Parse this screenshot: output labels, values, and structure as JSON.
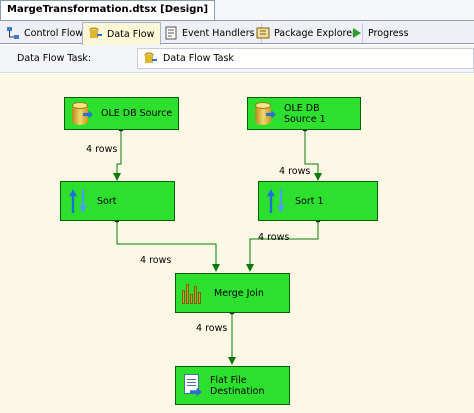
{
  "window": {
    "doc_tab": "MargeTransformation.dtsx [Design]"
  },
  "tabs": [
    {
      "label": "Control Flow",
      "icon": "control-flow-icon"
    },
    {
      "label": "Data Flow",
      "icon": "data-flow-icon"
    },
    {
      "label": "Event Handlers",
      "icon": "event-handlers-icon"
    },
    {
      "label": "Package Explorer",
      "icon": "package-explorer-icon"
    },
    {
      "label": "Progress",
      "icon": "progress-icon"
    }
  ],
  "active_tab": "Data Flow",
  "task": {
    "label": "Data Flow Task:",
    "value": "Data Flow Task"
  },
  "colors": {
    "node_fill": "#2ee02e",
    "node_border": "#0a5e0a",
    "canvas": "#fdf8e5",
    "link": "#0b7a0b"
  },
  "nodes": {
    "source1": {
      "label": "OLE DB Source"
    },
    "source2": {
      "label": "OLE DB Source 1"
    },
    "sort1": {
      "label": "Sort"
    },
    "sort2": {
      "label": "Sort 1"
    },
    "merge": {
      "label": "Merge Join"
    },
    "dest": {
      "label": "Flat File Destination"
    }
  },
  "links": {
    "source1_sort": "4 rows",
    "source2_sort1": "4 rows",
    "sort_merge": "4 rows",
    "sort1_merge": "4 rows",
    "merge_dest": "4 rows"
  }
}
